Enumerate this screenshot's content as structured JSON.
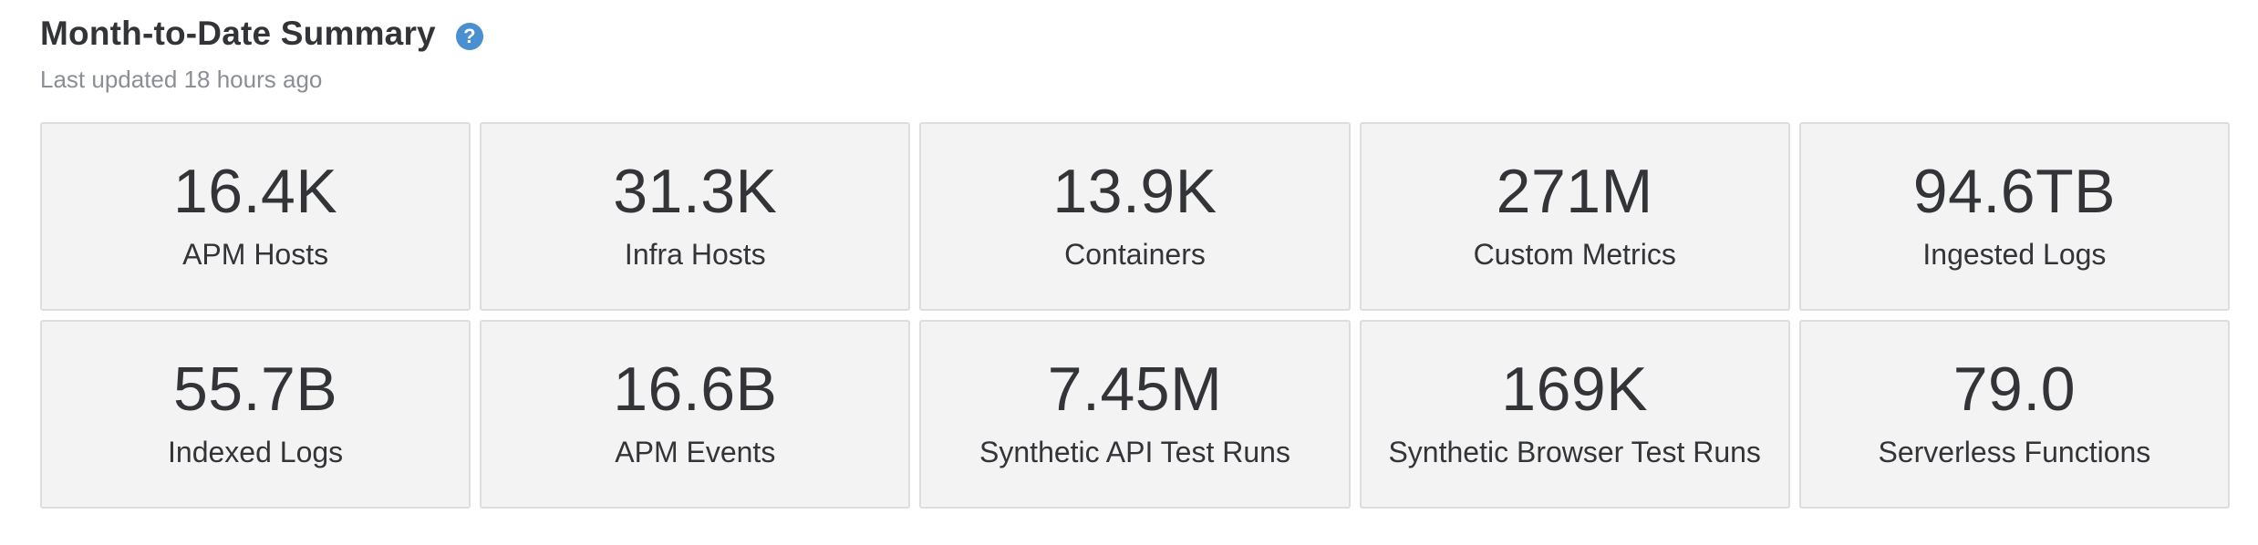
{
  "header": {
    "title": "Month-to-Date Summary",
    "help_icon_glyph": "?",
    "subtitle": "Last updated 18 hours ago"
  },
  "colors": {
    "help_icon": "#4a8fd0",
    "card_background": "#f3f3f3",
    "card_border": "#dddddd",
    "text_primary": "#333438",
    "text_muted": "#8b8e95"
  },
  "icons": {
    "help": "question-circle-icon"
  },
  "cards": [
    {
      "value": "16.4K",
      "label": "APM Hosts"
    },
    {
      "value": "31.3K",
      "label": "Infra Hosts"
    },
    {
      "value": "13.9K",
      "label": "Containers"
    },
    {
      "value": "271M",
      "label": "Custom Metrics"
    },
    {
      "value": "94.6TB",
      "label": "Ingested Logs"
    },
    {
      "value": "55.7B",
      "label": "Indexed Logs"
    },
    {
      "value": "16.6B",
      "label": "APM Events"
    },
    {
      "value": "7.45M",
      "label": "Synthetic API Test Runs"
    },
    {
      "value": "169K",
      "label": "Synthetic Browser Test Runs"
    },
    {
      "value": "79.0",
      "label": "Serverless Functions"
    }
  ]
}
